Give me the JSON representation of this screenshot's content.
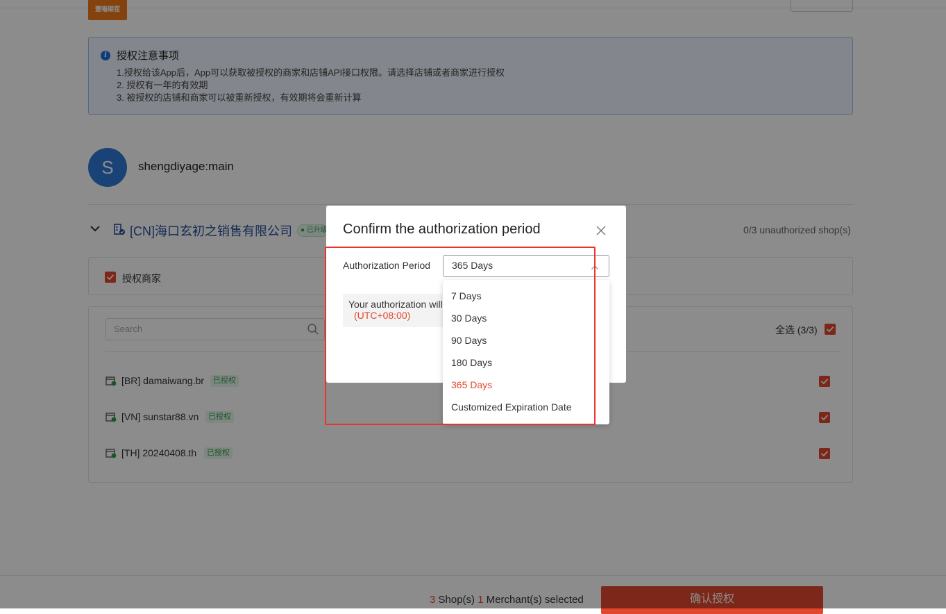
{
  "header": {
    "logo_text": "壹嗡碳茬"
  },
  "notice": {
    "title": "授权注意事项",
    "lines": [
      "1.授权给该App后，App可以获取被授权的商家和店铺API接口权限。请选择店铺或者商家进行授权",
      "2. 授权有一年的有效期",
      "3. 被授权的店铺和商家可以被重新授权，有效期将会重新计算"
    ]
  },
  "account": {
    "avatar_letter": "S",
    "name": "shengdiyage:main"
  },
  "merchant": {
    "name": "[CN]海口玄初之销售有限公司",
    "badge": "已升级",
    "unauthorized_count": "0/3 unauthorized shop(s)",
    "authorize_merchant_label": "授权商家"
  },
  "shops": {
    "search_placeholder": "Search",
    "select_all_label": "全选 (3/3)",
    "items": [
      {
        "name": "[BR] damaiwang.br",
        "status": "已授权"
      },
      {
        "name": "[VN] sunstar88.vn",
        "status": "已授权"
      },
      {
        "name": "[TH] 20240408.th",
        "status": "已授权"
      }
    ]
  },
  "footer": {
    "shop_count": "3",
    "shop_label": " Shop(s) ",
    "merchant_count": "1",
    "merchant_label": " Merchant(s) selected",
    "confirm_button": "确认授权"
  },
  "modal": {
    "title": "Confirm the authorization period",
    "period_label": "Authorization Period",
    "period_value": "365 Days",
    "info_text": "Your authorization will",
    "timezone": "(UTC+08:00)",
    "options": [
      "7 Days",
      "30 Days",
      "90 Days",
      "180 Days",
      "365 Days",
      "Customized Expiration Date"
    ],
    "selected_option": "365 Days"
  },
  "colors": {
    "accent": "#e2482e",
    "highlight_box": "#f0312a",
    "link_blue": "#2a4f9a",
    "success_green": "#2f9a4f"
  }
}
